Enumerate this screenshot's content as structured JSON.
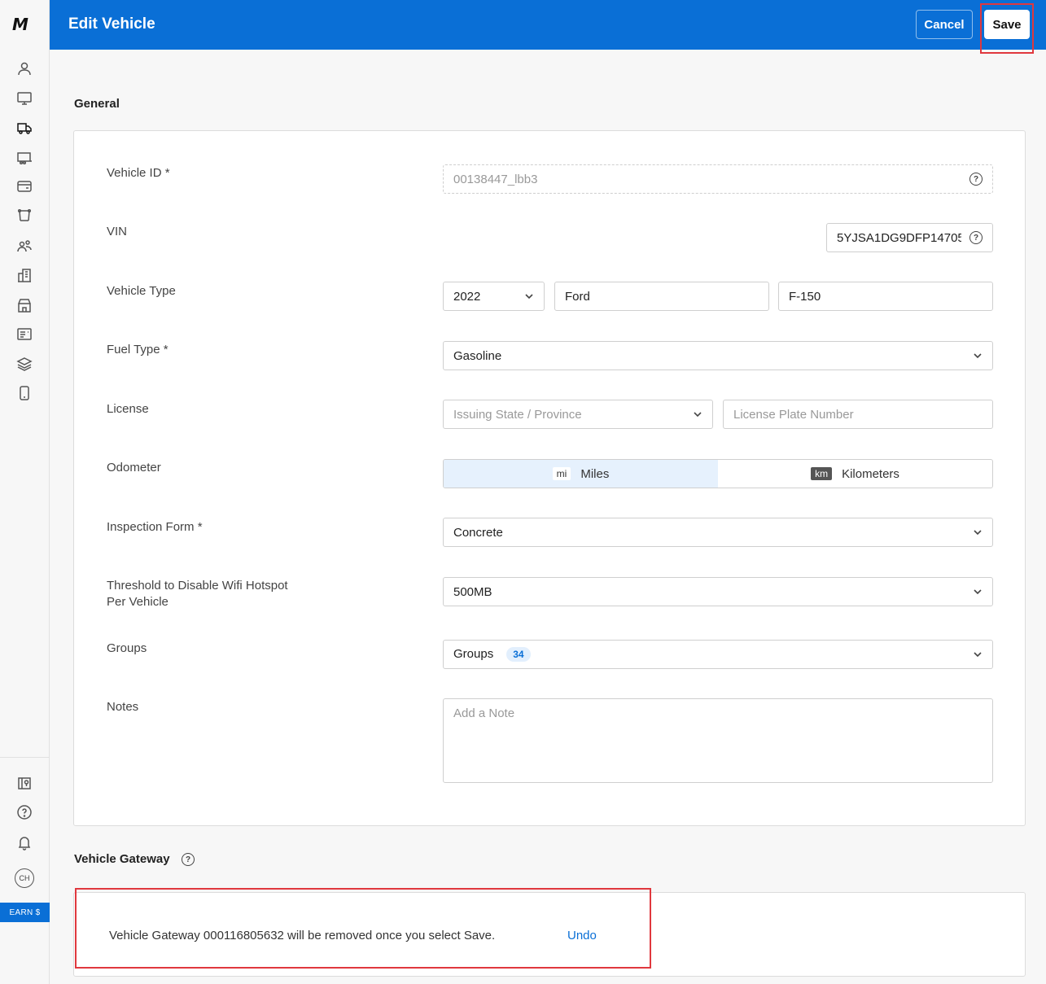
{
  "app": {
    "logo": "M"
  },
  "sidebar": {
    "icons": [
      "user-icon",
      "monitor-icon",
      "truck-icon",
      "trailer-icon",
      "card-icon",
      "route-icon",
      "people-icon",
      "building-icon",
      "store-icon",
      "inventory-icon",
      "layers-icon",
      "phone-icon"
    ],
    "bottom_icons": [
      "map-icon",
      "help-icon",
      "bell-icon"
    ],
    "avatar": "CH",
    "earn_label": "EARN $"
  },
  "header": {
    "title": "Edit Vehicle",
    "cancel_label": "Cancel",
    "save_label": "Save",
    "accent": "#0a6fd6"
  },
  "general": {
    "title": "General",
    "vehicle_id": {
      "label": "Vehicle ID *",
      "value": "00138447_lbb3"
    },
    "vin": {
      "label": "VIN",
      "value": "5YJSA1DG9DFP14705"
    },
    "vehicle_type": {
      "label": "Vehicle Type",
      "year": "2022",
      "make": "Ford",
      "model": "F-150"
    },
    "fuel_type": {
      "label": "Fuel Type *",
      "value": "Gasoline"
    },
    "license": {
      "label": "License",
      "state_placeholder": "Issuing State / Province",
      "plate_placeholder": "License Plate Number"
    },
    "odometer": {
      "label": "Odometer",
      "miles_badge": "mi",
      "miles_label": "Miles",
      "km_badge": "km",
      "km_label": "Kilometers",
      "selected": "Miles"
    },
    "inspection_form": {
      "label": "Inspection Form *",
      "value": "Concrete"
    },
    "wifi_threshold": {
      "label_line1": "Threshold to Disable Wifi Hotspot",
      "label_line2": "Per Vehicle",
      "value": "500MB"
    },
    "groups": {
      "label": "Groups",
      "value": "Groups",
      "count": "34"
    },
    "notes": {
      "label": "Notes",
      "placeholder": "Add a Note"
    }
  },
  "gateway": {
    "title": "Vehicle Gateway",
    "message": "Vehicle Gateway 000116805632 will be removed once you select Save.",
    "undo_label": "Undo",
    "highlight_color": "#e0383e"
  }
}
